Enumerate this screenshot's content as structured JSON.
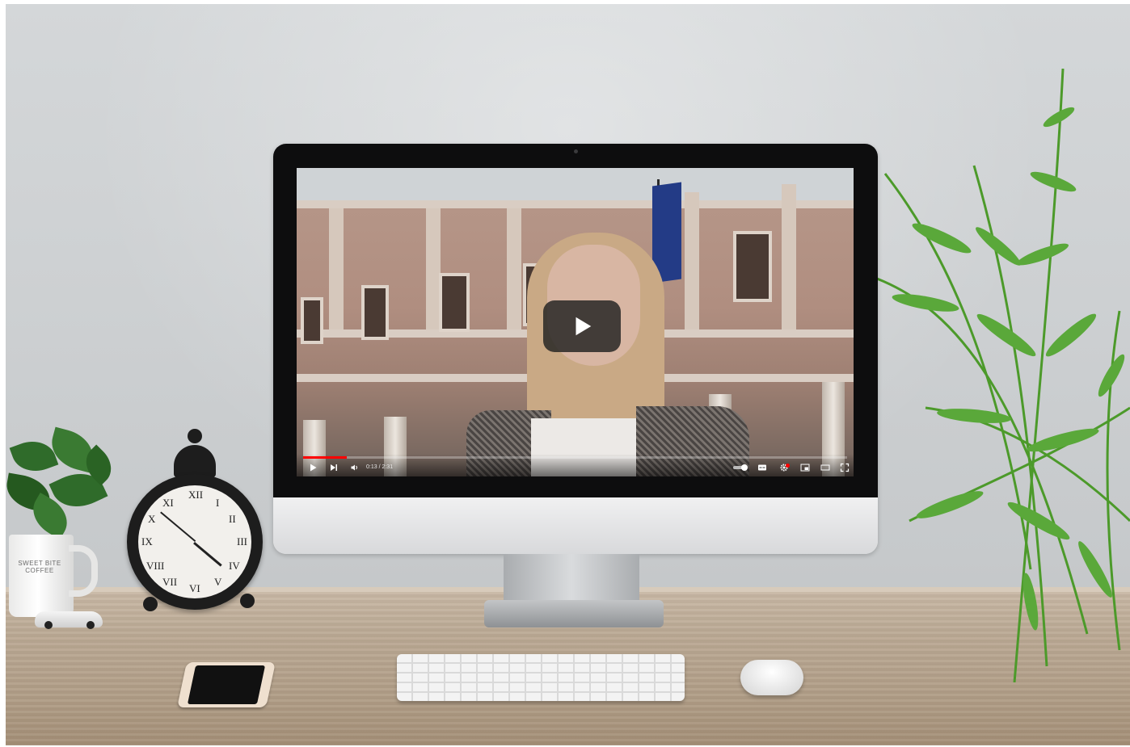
{
  "video_player": {
    "time_display": "0:13 / 2:31",
    "progress_fraction": 0.08,
    "controls": [
      {
        "name": "play-icon",
        "label": "▶"
      },
      {
        "name": "next-icon",
        "label": "⏭"
      },
      {
        "name": "volume-icon",
        "label": "🔊"
      },
      {
        "name": "autoplay-toggle-icon",
        "label": ""
      },
      {
        "name": "subtitles-icon",
        "label": ""
      },
      {
        "name": "settings-icon",
        "label": "⚙"
      },
      {
        "name": "miniplayer-icon",
        "label": ""
      },
      {
        "name": "theater-mode-icon",
        "label": ""
      },
      {
        "name": "fullscreen-icon",
        "label": "⛶"
      }
    ],
    "accent_color": "#ff0000"
  },
  "scene": {
    "mug_text": "SWEET BITE COFFEE"
  }
}
